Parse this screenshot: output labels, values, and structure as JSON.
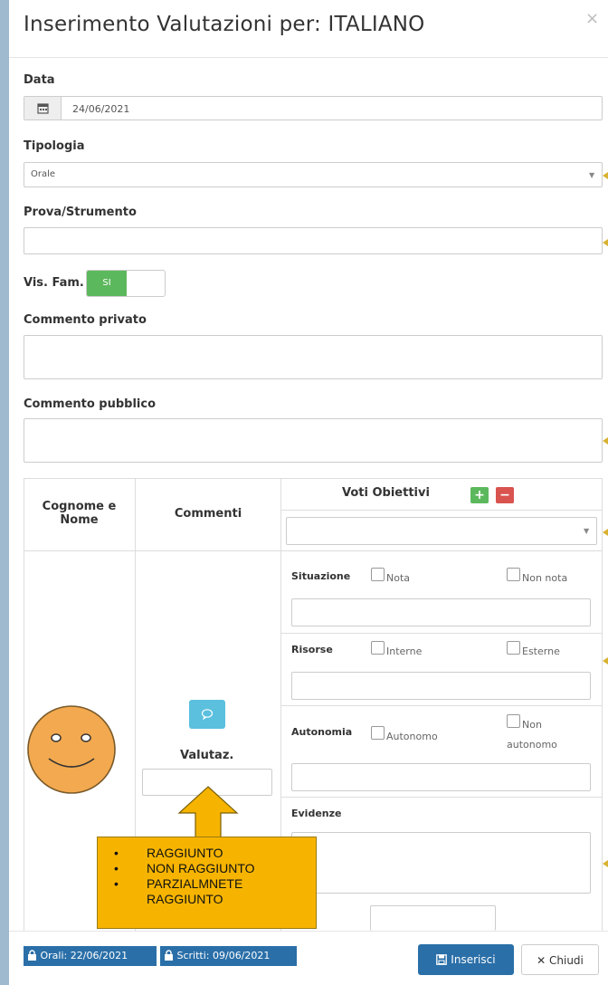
{
  "modal": {
    "title": "Inserimento Valutazioni per: ITALIANO",
    "close": "×"
  },
  "form": {
    "data_label": "Data",
    "data_value": "24/06/2021",
    "tipologia_label": "Tipologia",
    "tipologia_value": "Orale",
    "prova_label": "Prova/Strumento",
    "prova_value": "",
    "visfam_label": "Vis. Fam.",
    "visfam_toggle": "SI",
    "commento_privato_label": "Commento privato",
    "commento_pubblico_label": "Commento pubblico"
  },
  "table": {
    "col_nome_line1": "Cognome e",
    "col_nome_line2": "Nome",
    "col_commenti": "Commenti",
    "col_voti": "Voti Obiettivi",
    "add": "+",
    "remove": "−",
    "valutaz_label": "Valutaz.",
    "situazione": "Situazione",
    "nota": "Nota",
    "non_nota": "Non nota",
    "risorse": "Risorse",
    "interne": "Interne",
    "esterne": "Esterne",
    "autonomia": "Autonomia",
    "autonomo": "Autonomo",
    "non_autonomo_1": "Non",
    "non_autonomo_2": "autonomo",
    "evidenze": "Evidenze"
  },
  "callout": {
    "items": [
      "RAGGIUNTO",
      "NON RAGGIUNTO",
      "PARZIALMNETE",
      "RAGGIUNTO"
    ]
  },
  "footer": {
    "orali": "Orali: 22/06/2021",
    "scritti": "Scritti: 09/06/2021",
    "inserisci": "Inserisci",
    "chiudi": "Chiudi"
  },
  "colors": {
    "primary": "#2a6fa8",
    "success": "#5cb85c",
    "danger": "#d9534f",
    "info": "#5bc0de",
    "callout": "#f6b400",
    "smiley": "#f3a94f"
  },
  "icons": [
    "calendar-icon",
    "chevron-down-icon",
    "comment-icon",
    "lock-icon",
    "save-icon",
    "close-icon",
    "smiley-avatar"
  ]
}
